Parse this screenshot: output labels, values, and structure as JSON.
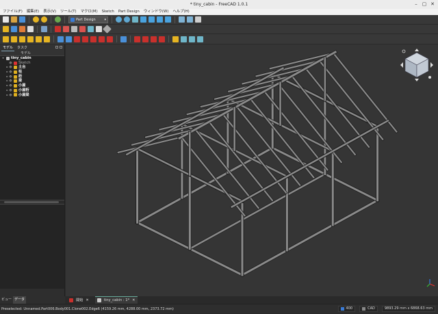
{
  "window": {
    "title": "* tiny_cabin - FreeCAD 1.0.1"
  },
  "menu": [
    "ファイル(F)",
    "編集(E)",
    "表示(V)",
    "ツール(T)",
    "マクロ(M)",
    "Sketch",
    "Part Design",
    "ウィンドウ(W)",
    "ヘルプ(H)"
  ],
  "toolbar": {
    "workbench": "Part Design"
  },
  "combo": {
    "tab_model": "モデル",
    "tab_tasks": "タスク",
    "tree_header": "モデル"
  },
  "tree": [
    {
      "label": "tiny_cabin",
      "level": 0,
      "icon": "document-icon",
      "bold": true,
      "color": "#c9c9c9"
    },
    {
      "label": "Sketch",
      "level": 1,
      "icon": "sketch-icon",
      "bold": false,
      "color": "#d33"
    },
    {
      "label": "土台",
      "level": 1,
      "icon": "body-icon",
      "bold": true,
      "color": "#e0b020"
    },
    {
      "label": "柱",
      "level": 1,
      "icon": "body-icon",
      "bold": true,
      "color": "#e0b020"
    },
    {
      "label": "桁",
      "level": 1,
      "icon": "body-icon",
      "bold": true,
      "color": "#e0b020"
    },
    {
      "label": "梁",
      "level": 1,
      "icon": "body-icon",
      "bold": true,
      "color": "#e0b020"
    },
    {
      "label": "小屋",
      "level": 1,
      "icon": "body-icon",
      "bold": true,
      "color": "#e0b020"
    },
    {
      "label": "小屋桁",
      "level": 1,
      "icon": "body-icon",
      "bold": true,
      "color": "#e0b020"
    },
    {
      "label": "小屋梁",
      "level": 1,
      "icon": "body-icon",
      "bold": true,
      "color": "#e0b020"
    }
  ],
  "bottom_tabs": {
    "view": "ビュー",
    "data": "データ"
  },
  "doc_tabs": [
    {
      "label": "開始",
      "active": false
    },
    {
      "label": "tiny_cabin : 1*",
      "active": true
    }
  ],
  "status": {
    "preselected": "Preselected: Unnamed.Part006.Body001.Clone002.Edge6 (4159.26 mm, 4288.00 mm, 2373.72 mm)",
    "mem": "400",
    "nav": "CAD",
    "dims": "9893.29 mm x 6868.63 mm"
  },
  "colors": {
    "accent": "#3a7bd5",
    "viewport_bg": "#353535",
    "frame": "#8a8a8a"
  }
}
